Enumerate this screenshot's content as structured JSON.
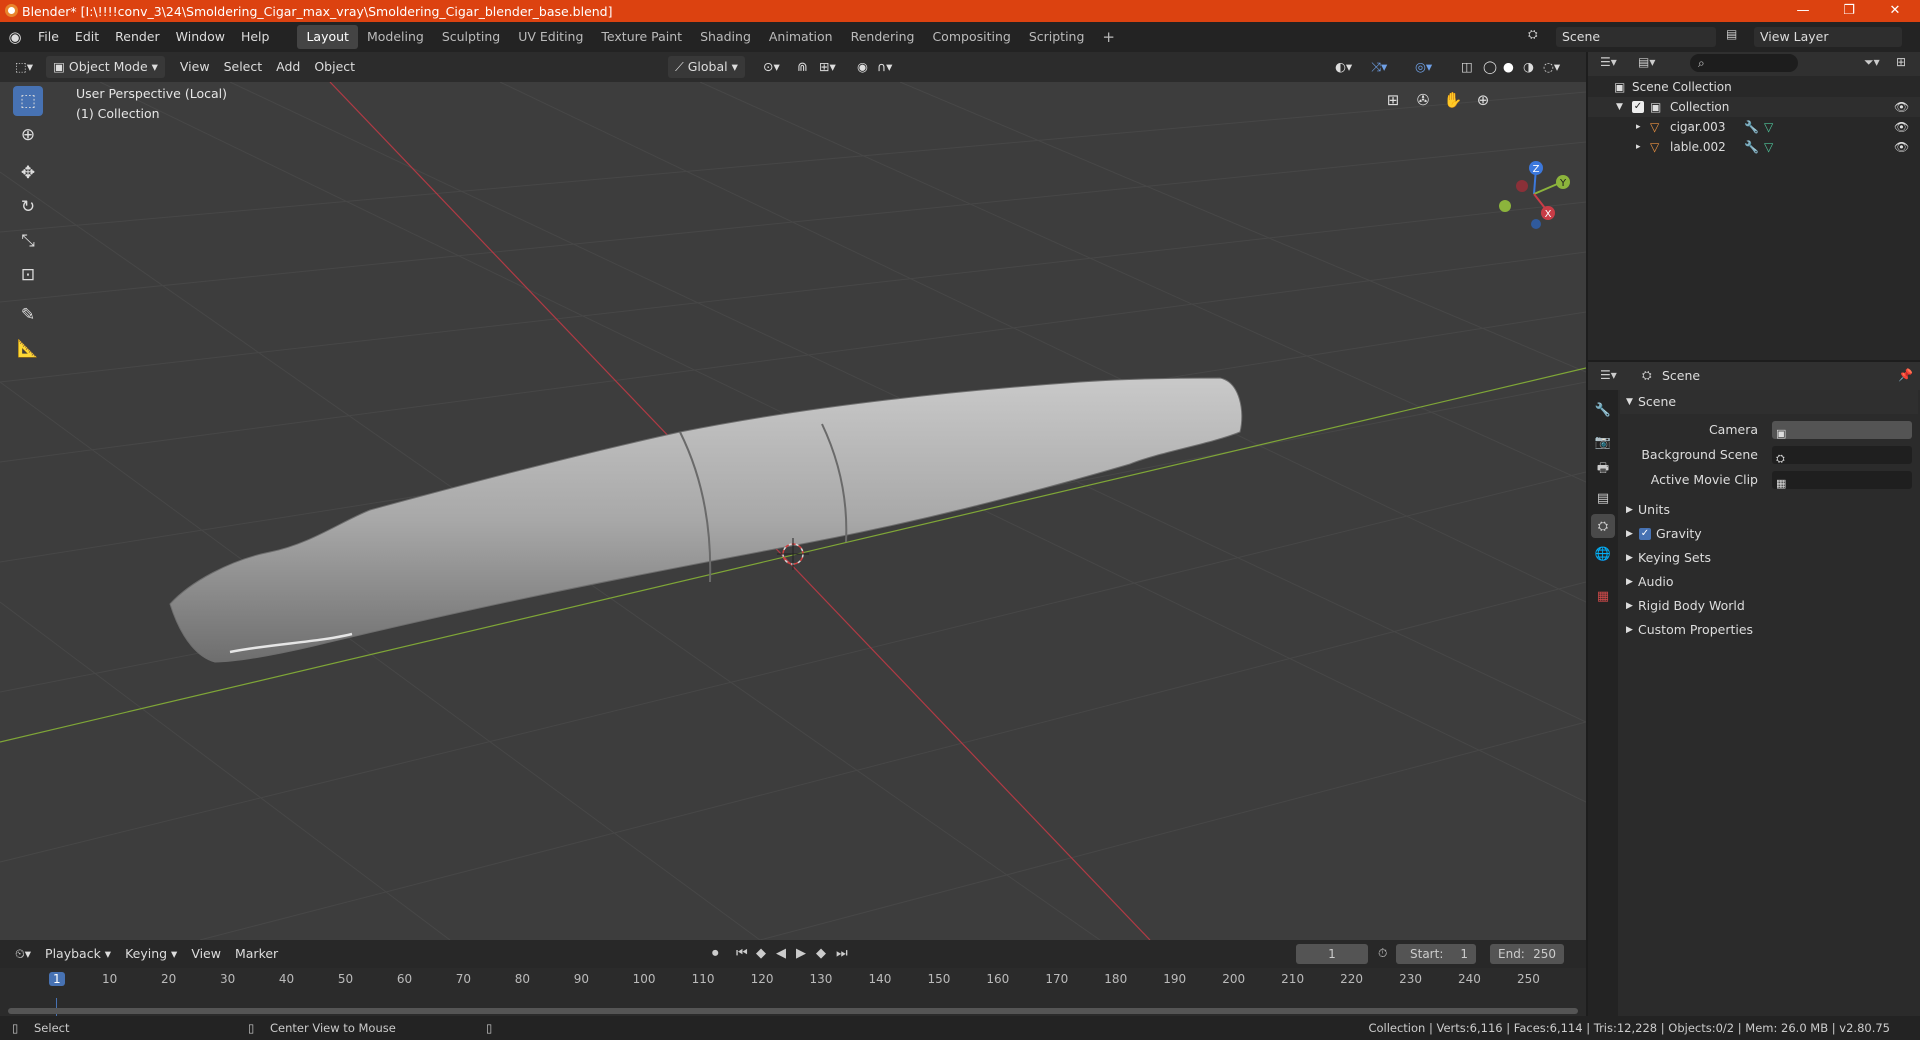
{
  "window": {
    "title": "Blender* [I:\\!!!!conv_3\\24\\Smoldering_Cigar_max_vray\\Smoldering_Cigar_blender_base.blend]"
  },
  "menus": [
    "File",
    "Edit",
    "Render",
    "Window",
    "Help"
  ],
  "workspaces": [
    "Layout",
    "Modeling",
    "Sculpting",
    "UV Editing",
    "Texture Paint",
    "Shading",
    "Animation",
    "Rendering",
    "Compositing",
    "Scripting"
  ],
  "scene_name": "Scene",
  "view_layer": "View Layer",
  "viewport_header": {
    "mode": "Object Mode",
    "view": "View",
    "select": "Select",
    "add": "Add",
    "object": "Object",
    "orientation": "Global"
  },
  "viewport": {
    "perspective": "User Perspective (Local)",
    "collection": "(1) Collection"
  },
  "gizmo": {
    "x": "X",
    "y": "Y",
    "z": "Z"
  },
  "outliner": {
    "root": "Scene Collection",
    "collection": "Collection",
    "items": [
      "cigar.003",
      "lable.002"
    ]
  },
  "properties": {
    "header": "Scene",
    "panel": "Scene",
    "camera_label": "Camera",
    "background_label": "Background Scene",
    "movieclip_label": "Active Movie Clip",
    "sections": [
      "Units",
      "Gravity",
      "Keying Sets",
      "Audio",
      "Rigid Body World",
      "Custom Properties"
    ]
  },
  "timeline": {
    "playback": "Playback",
    "keying": "Keying",
    "view": "View",
    "marker": "Marker",
    "current_frame": "1",
    "start_label": "Start:",
    "start": "1",
    "end_label": "End:",
    "end": "250",
    "ticks": [
      "1",
      "10",
      "20",
      "30",
      "40",
      "50",
      "60",
      "70",
      "80",
      "90",
      "100",
      "110",
      "120",
      "130",
      "140",
      "150",
      "160",
      "170",
      "180",
      "190",
      "200",
      "210",
      "220",
      "230",
      "240",
      "250"
    ]
  },
  "statusbar": {
    "left": "Select",
    "middle": "Center View to Mouse",
    "right": "Collection | Verts:6,116 | Faces:6,114 | Tris:12,228 | Objects:0/2 | Mem: 26.0 MB | v2.80.75"
  },
  "colors": {
    "accent": "#4772b3",
    "titlebar": "#dc4210",
    "x_axis": "#c83c46",
    "y_axis": "#8cb43c",
    "z_axis": "#3c78dc"
  }
}
